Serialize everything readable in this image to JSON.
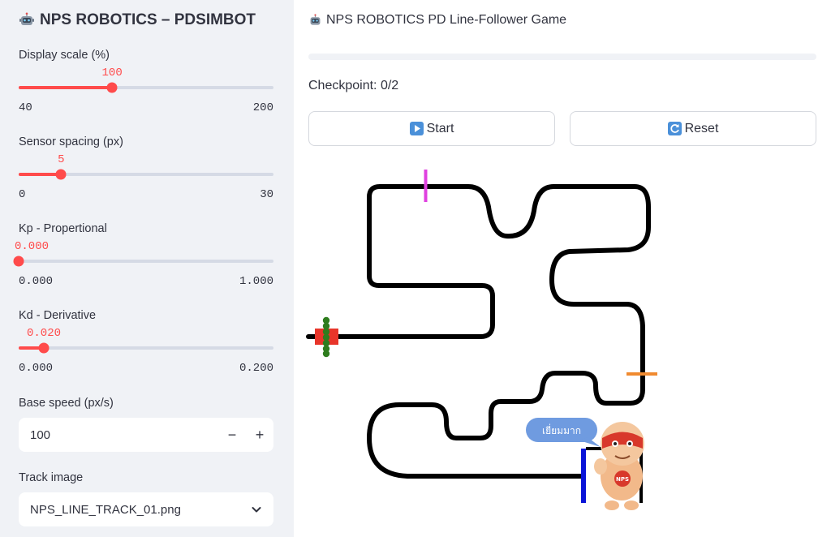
{
  "sidebar": {
    "title": "NPS ROBOTICS – PDSIMBOT",
    "title_icon": "robot-icon",
    "sliders": [
      {
        "label": "Display scale (%)",
        "value": "100",
        "min": "40",
        "max": "200",
        "fraction": 0.3667
      },
      {
        "label": "Sensor spacing (px)",
        "value": "5",
        "min": "0",
        "max": "30",
        "fraction": 0.1667
      },
      {
        "label": "Kp - Propertional",
        "value": "0.000",
        "min": "0.000",
        "max": "1.000",
        "fraction": 0.0
      },
      {
        "label": "Kd - Derivative",
        "value": "0.020",
        "min": "0.000",
        "max": "0.200",
        "fraction": 0.1
      }
    ],
    "base_speed": {
      "label": "Base speed (px/s)",
      "value": "100",
      "minus": "−",
      "plus": "+"
    },
    "track_image": {
      "label": "Track image",
      "value": "NPS_LINE_TRACK_01.png"
    }
  },
  "main": {
    "title": "NPS ROBOTICS PD Line-Follower Game",
    "title_icon": "robot-icon",
    "progress": 0.0,
    "checkpoint": "Checkpoint: 0/2",
    "start_label": "Start",
    "start_icon": "play-icon",
    "reset_label": "Reset",
    "reset_icon": "reset-icon",
    "speech_bubble": "เยี่ยมมาก",
    "mascot_badge": "NPS"
  },
  "colors": {
    "accent": "#ff4b4b",
    "sidebar_bg": "#f0f2f6",
    "track": "#000000",
    "checkpoint_pink": "#e040e0",
    "checkpoint_orange": "#f08a30",
    "robot_body": "#e8352a",
    "robot_sensors": "#2e7d1e",
    "finish_line": "#0a14d8",
    "bubble": "#6f9be0"
  }
}
